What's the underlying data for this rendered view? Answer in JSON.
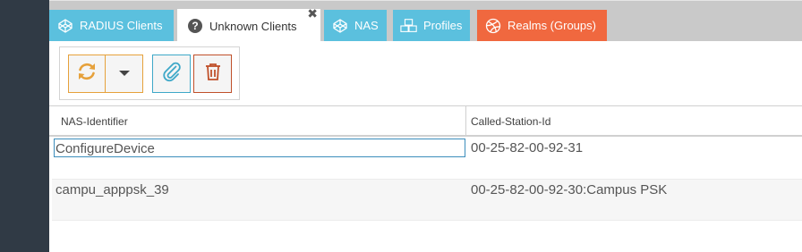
{
  "tabs": [
    {
      "label": "RADIUS Clients",
      "icon": "codepen-icon"
    },
    {
      "label": "Unknown Clients",
      "icon": "question-circle-icon"
    },
    {
      "label": "NAS",
      "icon": "codepen-icon"
    },
    {
      "label": "Profiles",
      "icon": "cubes-icon"
    },
    {
      "label": "Realms (Groups)",
      "icon": "dribbble-icon"
    }
  ],
  "active_tab": "Unknown Clients",
  "toolbar": {
    "reload_icon": "refresh-icon",
    "menu_icon": "caret-down-icon",
    "attach_icon": "paperclip-icon",
    "delete_icon": "trash-icon"
  },
  "grid": {
    "columns": [
      "NAS-Identifier",
      "Called-Station-Id"
    ],
    "rows": [
      {
        "nas_identifier": "ConfigureDevice",
        "called_station_id": "00-25-82-00-92-31",
        "editing": true
      },
      {
        "nas_identifier": "campu_apppsk_39",
        "called_station_id": "00-25-82-00-92-30:Campus PSK",
        "editing": false
      }
    ]
  },
  "colors": {
    "sidebar": "#303a45",
    "tab_info": "#5bc0de",
    "tab_realms": "#f0683f",
    "warning": "#e6a13b",
    "danger": "#c0502a"
  }
}
